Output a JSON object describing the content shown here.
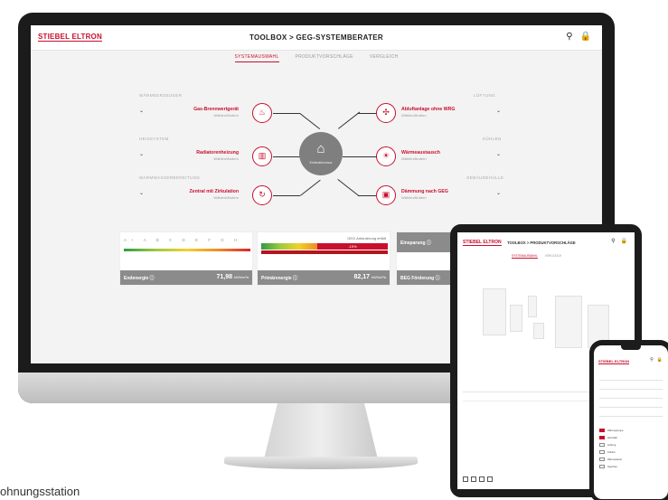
{
  "app": {
    "logo": "STIEBEL ELTRON",
    "title": "TOOLBOX > GEG-SYSTEMBERATER",
    "tabs": [
      "SYSTEMAUSWAHL",
      "PRODUKTVORSCHLÄGE",
      "VERGLEICH"
    ],
    "active_tab": 0
  },
  "left_rows": [
    {
      "category": "WÄRMEERZEUGER",
      "name": "Gas-Brennwertgerät",
      "sub": "Wählen/Ändern",
      "icon": "flame-icon",
      "glyph": "🔥"
    },
    {
      "category": "HEIZSYSTEM",
      "name": "Radiatorenheizung",
      "sub": "Wählen/Ändern",
      "icon": "radiator-icon",
      "glyph": "▥"
    },
    {
      "category": "WARMWASSERBEREITUNG",
      "name": "Zentral mit Zirkulation",
      "sub": "Wählen/Ändern",
      "icon": "circulation-icon",
      "glyph": "↻"
    }
  ],
  "right_rows": [
    {
      "category": "LÜFTUNG",
      "name": "Abluftanlage ohne WRG",
      "sub": "Wählen/Ändern",
      "icon": "fan-icon",
      "glyph": "✣"
    },
    {
      "category": "KÜHLEN",
      "name": "Wärmeaustausch",
      "sub": "Wählen/Ändern",
      "icon": "sun-icon",
      "glyph": "☀"
    },
    {
      "category": "GEBÄUDEHÜLLE",
      "name": "Dämmung nach GEG",
      "sub": "Wählen/Ändern",
      "icon": "insulation-icon",
      "glyph": "▣"
    }
  ],
  "hub": {
    "label": "Einfamilienhaus",
    "icon": "house-icon"
  },
  "energy": {
    "scale": [
      "A+",
      "A",
      "B",
      "C",
      "D",
      "E",
      "F",
      "G",
      "H"
    ],
    "endenergie_label": "Endenergie",
    "endenergie_value": "71,98",
    "unit": "kWh/m²a",
    "primaerenergie_label": "Primärenergie",
    "primaerenergie_value": "82,17",
    "geg_label": "GEG Anforderung erfüllt",
    "geg_percent": "-15%",
    "einsparung_label": "Einsparung",
    "foerderung_label": "BEG Förderung"
  },
  "tablet": {
    "logo": "STIEBEL ELTRON",
    "title": "TOOLBOX > PRODUKTVORSCHLÄGE",
    "tabs": [
      "SYSTEMAUSWAHL",
      "VERGLEICH"
    ]
  },
  "phone": {
    "logo": "STIEBEL ELTRON",
    "items": [
      "Wärmepumpe",
      "Heizstab",
      "Lüftung",
      "Kühlen",
      "Warmwasser",
      "Speicher"
    ]
  },
  "caption": "ohnungsstation",
  "colors": {
    "brand": "#c8102e",
    "hub": "#7f7f7f",
    "bar_dark": "#8b8b8b"
  }
}
